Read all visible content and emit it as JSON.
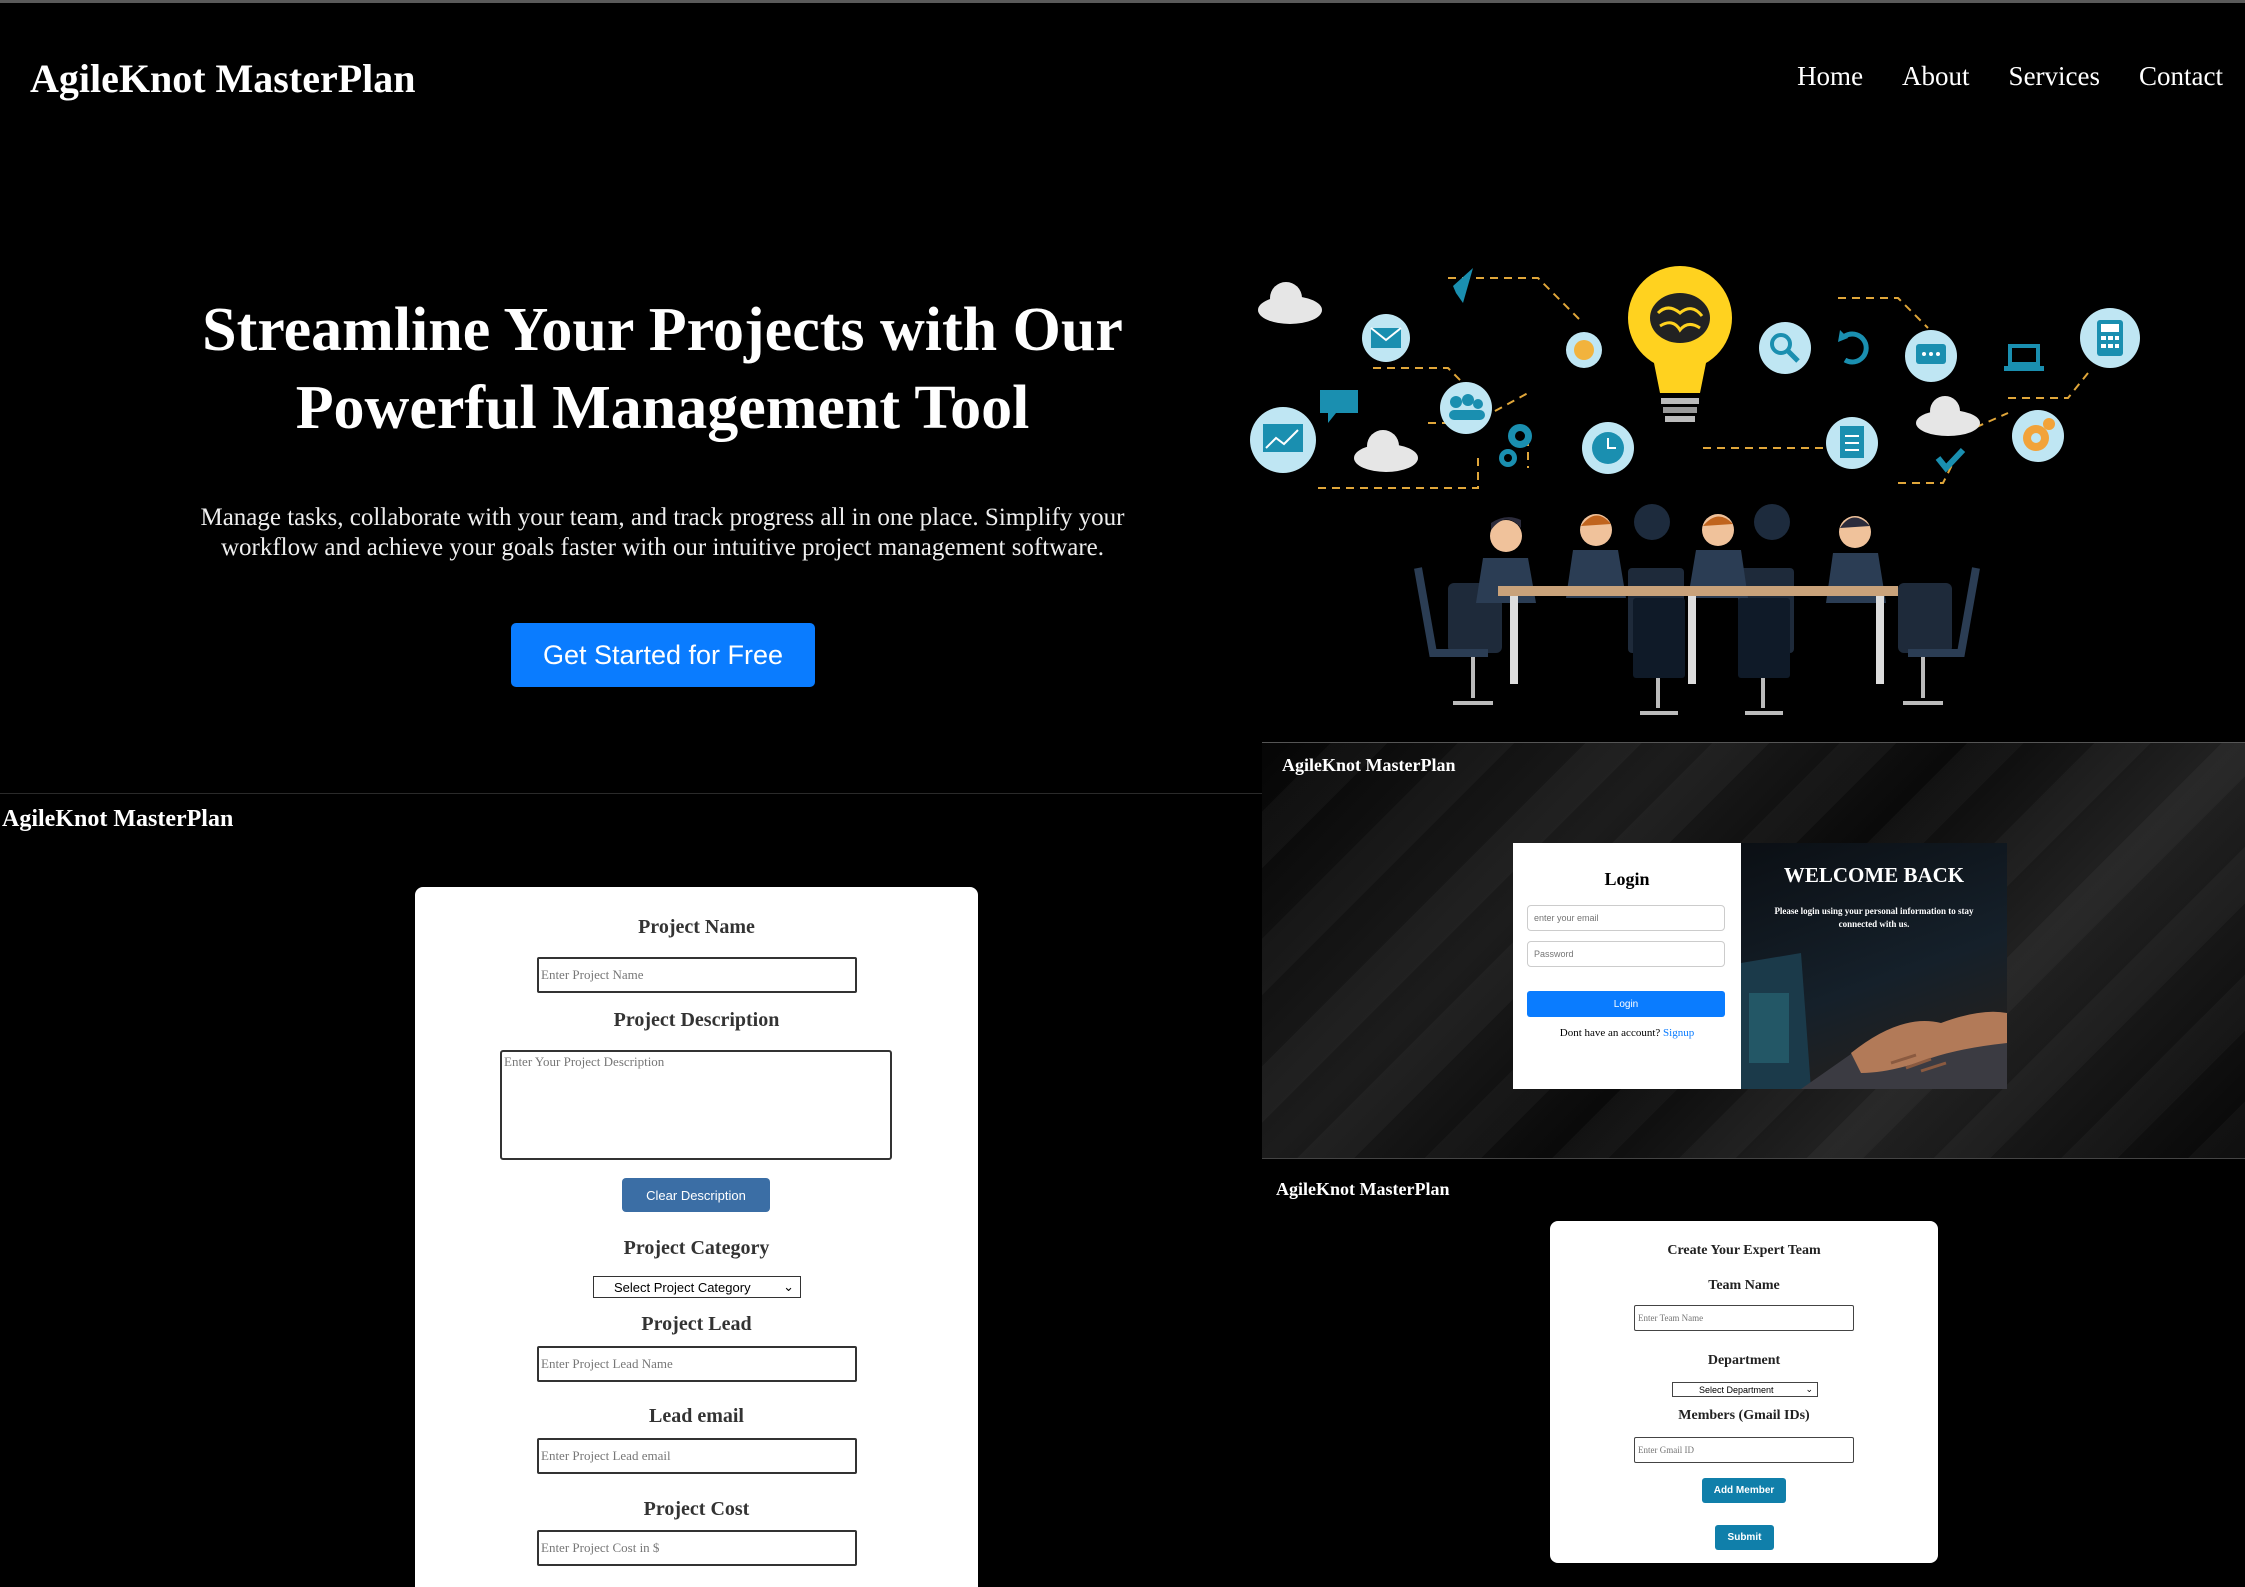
{
  "landing": {
    "brand": "AgileKnot MasterPlan",
    "nav": [
      "Home",
      "About",
      "Services",
      "Contact"
    ],
    "hero_title_line1": "Streamline Your Projects with Our",
    "hero_title_line2": "Powerful Management Tool",
    "hero_subtitle_line1": "Manage tasks, collaborate with your team, and track progress all in one place. Simplify your",
    "hero_subtitle_line2": "workflow and achieve your goals faster with our intuitive project management software.",
    "cta": "Get Started for Free"
  },
  "project_form": {
    "brand": "AgileKnot MasterPlan",
    "project_name_label": "Project Name",
    "project_name_placeholder": "Enter Project Name",
    "description_label": "Project Description",
    "description_placeholder": "Enter Your Project Description",
    "clear_button": "Clear Description",
    "category_label": "Project Category",
    "category_selected": "Select Project Category",
    "lead_label": "Project Lead",
    "lead_placeholder": "Enter Project Lead Name",
    "email_label": "Lead email",
    "email_placeholder": "Enter Project Lead email",
    "cost_label": "Project Cost",
    "cost_placeholder": "Enter Project Cost in $"
  },
  "login": {
    "brand": "AgileKnot MasterPlan",
    "title": "Login",
    "email_placeholder": "enter your email",
    "password_placeholder": "Password",
    "button": "Login",
    "signup_prompt": "Dont have an account?",
    "signup_link": "Signup",
    "welcome_title": "WELCOME BACK",
    "welcome_sub": "Please login using your personal information to stay connected with us."
  },
  "team_form": {
    "brand": "AgileKnot MasterPlan",
    "title": "Create Your Expert Team",
    "team_name_label": "Team Name",
    "team_name_placeholder": "Enter Team Name",
    "department_label": "Department",
    "department_selected": "Select Department",
    "members_label": "Members (Gmail IDs)",
    "members_placeholder": "Enter Gmail ID",
    "add_button": "Add Member",
    "submit_button": "Submit"
  },
  "colors": {
    "primary_blue": "#0a7cff",
    "clear_button": "#3b6ea5",
    "team_button": "#107faa",
    "icon_teal": "#1a8fb0",
    "bulb_yellow": "#ffd21f"
  }
}
